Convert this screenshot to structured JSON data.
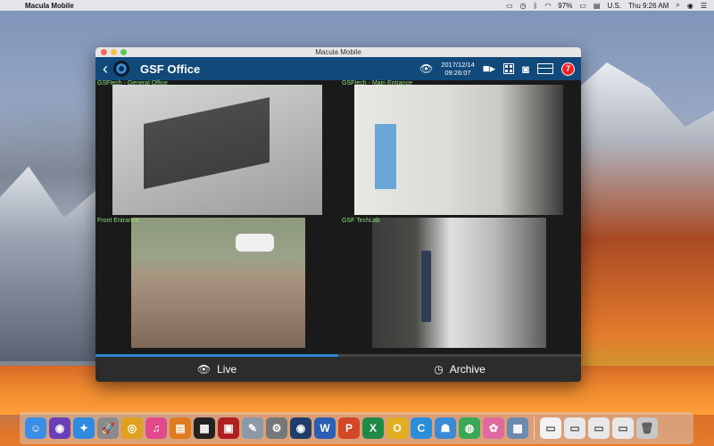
{
  "menubar": {
    "app_name": "Macula Mobile",
    "battery": "97%",
    "input_source": "U.S.",
    "clock": "Thu 9:26 AM"
  },
  "window": {
    "title": "Macula Mobile"
  },
  "header": {
    "title": "GSF Office",
    "date": "2017/12/14",
    "time": "09:26:07",
    "badge_count": "7"
  },
  "cameras": [
    {
      "label": "GSFtech - General Office"
    },
    {
      "label": "GSFtech - Main Entrance"
    },
    {
      "label": "Front Entrance"
    },
    {
      "label": "GSF TechLab"
    }
  ],
  "tabs": {
    "live": "Live",
    "archive": "Archive"
  },
  "colors": {
    "header_bg": "#11497a",
    "active_tab_accent": "#2a86d2",
    "camera_label": "#8fe27c",
    "badge": "#e22222"
  },
  "dock": {
    "items": [
      {
        "icon": "finder-icon",
        "glyph": "☺",
        "color": "#3a8ee6"
      },
      {
        "icon": "siri-icon",
        "glyph": "◉",
        "color": "#6b3fb8"
      },
      {
        "icon": "safari-icon",
        "glyph": "✦",
        "color": "#2f8ae0"
      },
      {
        "icon": "launchpad-icon",
        "glyph": "🚀",
        "color": "#8a8a8a"
      },
      {
        "icon": "chrome-icon",
        "glyph": "◎",
        "color": "#e0a020"
      },
      {
        "icon": "itunes-icon",
        "glyph": "♫",
        "color": "#e04a8a"
      },
      {
        "icon": "books-icon",
        "glyph": "▤",
        "color": "#e07b20"
      },
      {
        "icon": "app-icon-dark",
        "glyph": "▦",
        "color": "#222"
      },
      {
        "icon": "photo-booth-icon",
        "glyph": "▣",
        "color": "#b02020"
      },
      {
        "icon": "preview-icon",
        "glyph": "✎",
        "color": "#8a9aa8"
      },
      {
        "icon": "system-preferences-icon",
        "glyph": "⚙",
        "color": "#777"
      },
      {
        "icon": "macula-icon",
        "glyph": "◉",
        "color": "#1f3d6b"
      },
      {
        "icon": "word-icon",
        "glyph": "W",
        "color": "#2b5fb3"
      },
      {
        "icon": "powerpoint-icon",
        "glyph": "P",
        "color": "#d24726"
      },
      {
        "icon": "excel-icon",
        "glyph": "X",
        "color": "#1e8a46"
      },
      {
        "icon": "app-o-icon",
        "glyph": "O",
        "color": "#e0b020"
      },
      {
        "icon": "app-c-icon",
        "glyph": "C",
        "color": "#2b8ed8"
      },
      {
        "icon": "people-icon",
        "glyph": "☗",
        "color": "#3a8ad6"
      },
      {
        "icon": "globe-icon",
        "glyph": "◍",
        "color": "#3aa856"
      },
      {
        "icon": "photos-icon",
        "glyph": "✿",
        "color": "#e06aa0"
      },
      {
        "icon": "image-capture-icon",
        "glyph": "▩",
        "color": "#6a8ab0"
      },
      {
        "icon": "document-icon",
        "glyph": "▭",
        "color": "#f2f2f2"
      },
      {
        "icon": "spreadsheet-file-icon",
        "glyph": "▭",
        "color": "#e8e8e8"
      },
      {
        "icon": "spreadsheet-file-icon",
        "glyph": "▭",
        "color": "#e8e8e8"
      },
      {
        "icon": "file-icon",
        "glyph": "▭",
        "color": "#e8e8e8"
      },
      {
        "icon": "trash-icon",
        "glyph": "🗑",
        "color": "#c8c8c8"
      }
    ]
  }
}
